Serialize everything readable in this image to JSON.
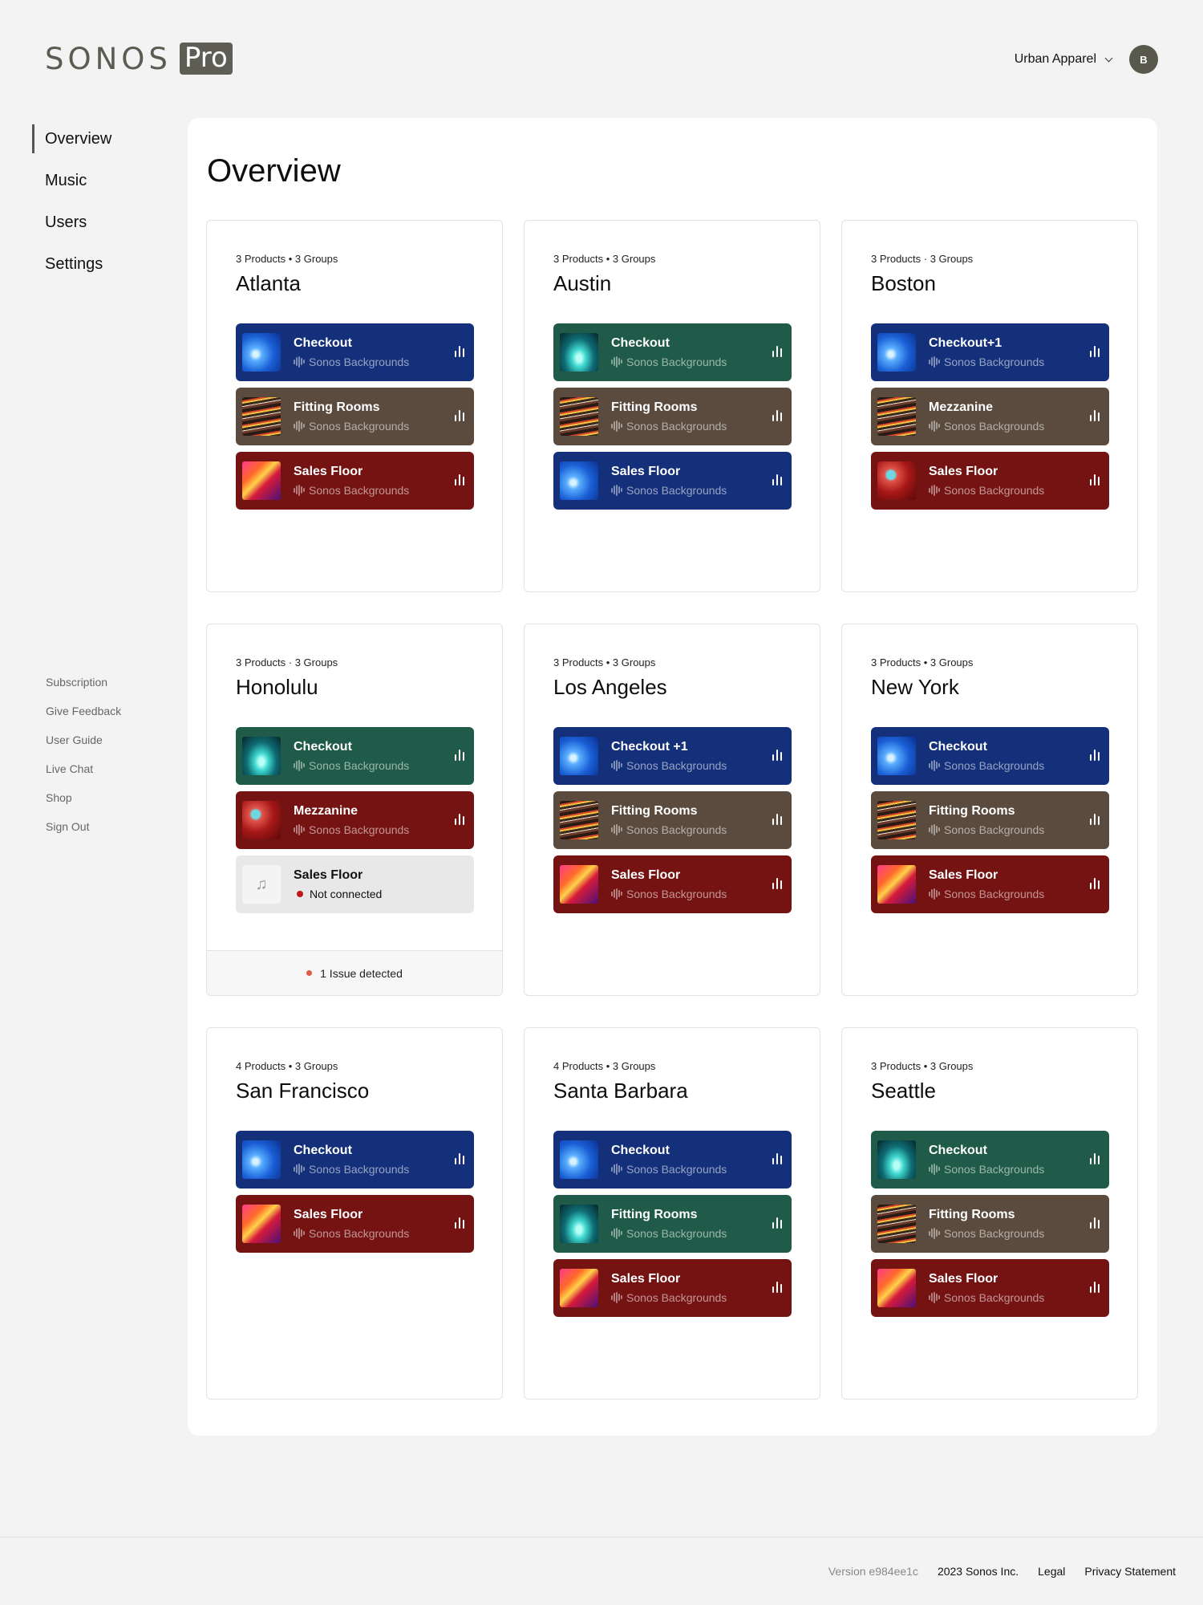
{
  "header": {
    "logo_word": "SONOS",
    "logo_badge": "Pro",
    "account_name": "Urban Apparel",
    "avatar_initial": "B"
  },
  "nav": {
    "items": [
      "Overview",
      "Music",
      "Users",
      "Settings"
    ],
    "active": "Overview"
  },
  "subnav": [
    "Subscription",
    "Give Feedback",
    "User Guide",
    "Live Chat",
    "Shop",
    "Sign Out"
  ],
  "main": {
    "title": "Overview"
  },
  "locations": [
    {
      "meta": "3 Products • 3 Groups",
      "name": "Atlanta",
      "groups": [
        {
          "name": "Checkout",
          "sub": "Sonos Backgrounds",
          "color": "blue",
          "thumb": "t-blue"
        },
        {
          "name": "Fitting Rooms",
          "sub": "Sonos Backgrounds",
          "color": "brown",
          "thumb": "t-brown"
        },
        {
          "name": "Sales Floor",
          "sub": "Sonos Backgrounds",
          "color": "red",
          "thumb": "t-red"
        }
      ]
    },
    {
      "meta": "3 Products • 3 Groups",
      "name": "Austin",
      "groups": [
        {
          "name": "Checkout",
          "sub": "Sonos Backgrounds",
          "color": "green",
          "thumb": "t-green"
        },
        {
          "name": "Fitting Rooms",
          "sub": "Sonos Backgrounds",
          "color": "brown",
          "thumb": "t-brown"
        },
        {
          "name": "Sales Floor",
          "sub": "Sonos Backgrounds",
          "color": "blue",
          "thumb": "t-blue"
        }
      ]
    },
    {
      "meta": "3 Products · 3 Groups",
      "name": "Boston",
      "groups": [
        {
          "name": "Checkout+1",
          "sub": "Sonos Backgrounds",
          "color": "blue",
          "thumb": "t-blue"
        },
        {
          "name": "Mezzanine",
          "sub": "Sonos Backgrounds",
          "color": "brown",
          "thumb": "t-brown"
        },
        {
          "name": "Sales Floor",
          "sub": "Sonos Backgrounds",
          "color": "red",
          "thumb": "t-room"
        }
      ]
    },
    {
      "meta": "3 Products · 3 Groups",
      "name": "Honolulu",
      "issue": "1 Issue detected",
      "groups": [
        {
          "name": "Checkout",
          "sub": "Sonos Backgrounds",
          "color": "green",
          "thumb": "t-green"
        },
        {
          "name": "Mezzanine",
          "sub": "Sonos Backgrounds",
          "color": "red",
          "thumb": "t-room"
        },
        {
          "name": "Sales Floor",
          "status": "Not connected",
          "color": "disconnected",
          "thumb": "t-empty",
          "thumb_icon": "♫"
        }
      ]
    },
    {
      "meta": "3 Products • 3 Groups",
      "name": "Los Angeles",
      "groups": [
        {
          "name": "Checkout +1",
          "sub": "Sonos Backgrounds",
          "color": "blue",
          "thumb": "t-blue"
        },
        {
          "name": "Fitting Rooms",
          "sub": "Sonos Backgrounds",
          "color": "brown",
          "thumb": "t-brown"
        },
        {
          "name": "Sales Floor",
          "sub": "Sonos Backgrounds",
          "color": "red",
          "thumb": "t-red"
        }
      ]
    },
    {
      "meta": "3 Products • 3 Groups",
      "name": "New York",
      "groups": [
        {
          "name": "Checkout",
          "sub": "Sonos Backgrounds",
          "color": "blue",
          "thumb": "t-blue"
        },
        {
          "name": "Fitting Rooms",
          "sub": "Sonos Backgrounds",
          "color": "brown",
          "thumb": "t-brown"
        },
        {
          "name": "Sales Floor",
          "sub": "Sonos Backgrounds",
          "color": "red",
          "thumb": "t-red"
        }
      ]
    },
    {
      "meta": "4 Products • 3 Groups",
      "name": "San Francisco",
      "groups": [
        {
          "name": "Checkout",
          "sub": "Sonos Backgrounds",
          "color": "blue",
          "thumb": "t-blue"
        },
        {
          "name": "Sales Floor",
          "sub": "Sonos Backgrounds",
          "color": "red",
          "thumb": "t-red"
        }
      ]
    },
    {
      "meta": "4 Products • 3 Groups",
      "name": "Santa Barbara",
      "groups": [
        {
          "name": "Checkout",
          "sub": "Sonos Backgrounds",
          "color": "blue",
          "thumb": "t-blue"
        },
        {
          "name": "Fitting Rooms",
          "sub": "Sonos Backgrounds",
          "color": "green",
          "thumb": "t-green"
        },
        {
          "name": "Sales Floor",
          "sub": "Sonos Backgrounds",
          "color": "red",
          "thumb": "t-red"
        }
      ]
    },
    {
      "meta": "3 Products • 3 Groups",
      "name": "Seattle",
      "groups": [
        {
          "name": "Checkout",
          "sub": "Sonos Backgrounds",
          "color": "green",
          "thumb": "t-green"
        },
        {
          "name": "Fitting Rooms",
          "sub": "Sonos Backgrounds",
          "color": "brown",
          "thumb": "t-brown"
        },
        {
          "name": "Sales Floor",
          "sub": "Sonos Backgrounds",
          "color": "red",
          "thumb": "t-red"
        }
      ]
    }
  ],
  "footer": {
    "version": "Version e984ee1c",
    "copyright": "2023 Sonos Inc.",
    "legal": "Legal",
    "privacy": "Privacy Statement"
  },
  "colors": {
    "blue": "#15307a",
    "brown": "#5a4b3e",
    "red": "#751313",
    "green": "#1f5b48",
    "disconnected": "#e8e8e8",
    "status_error": "#c01818",
    "issue": "#e05a4a"
  }
}
